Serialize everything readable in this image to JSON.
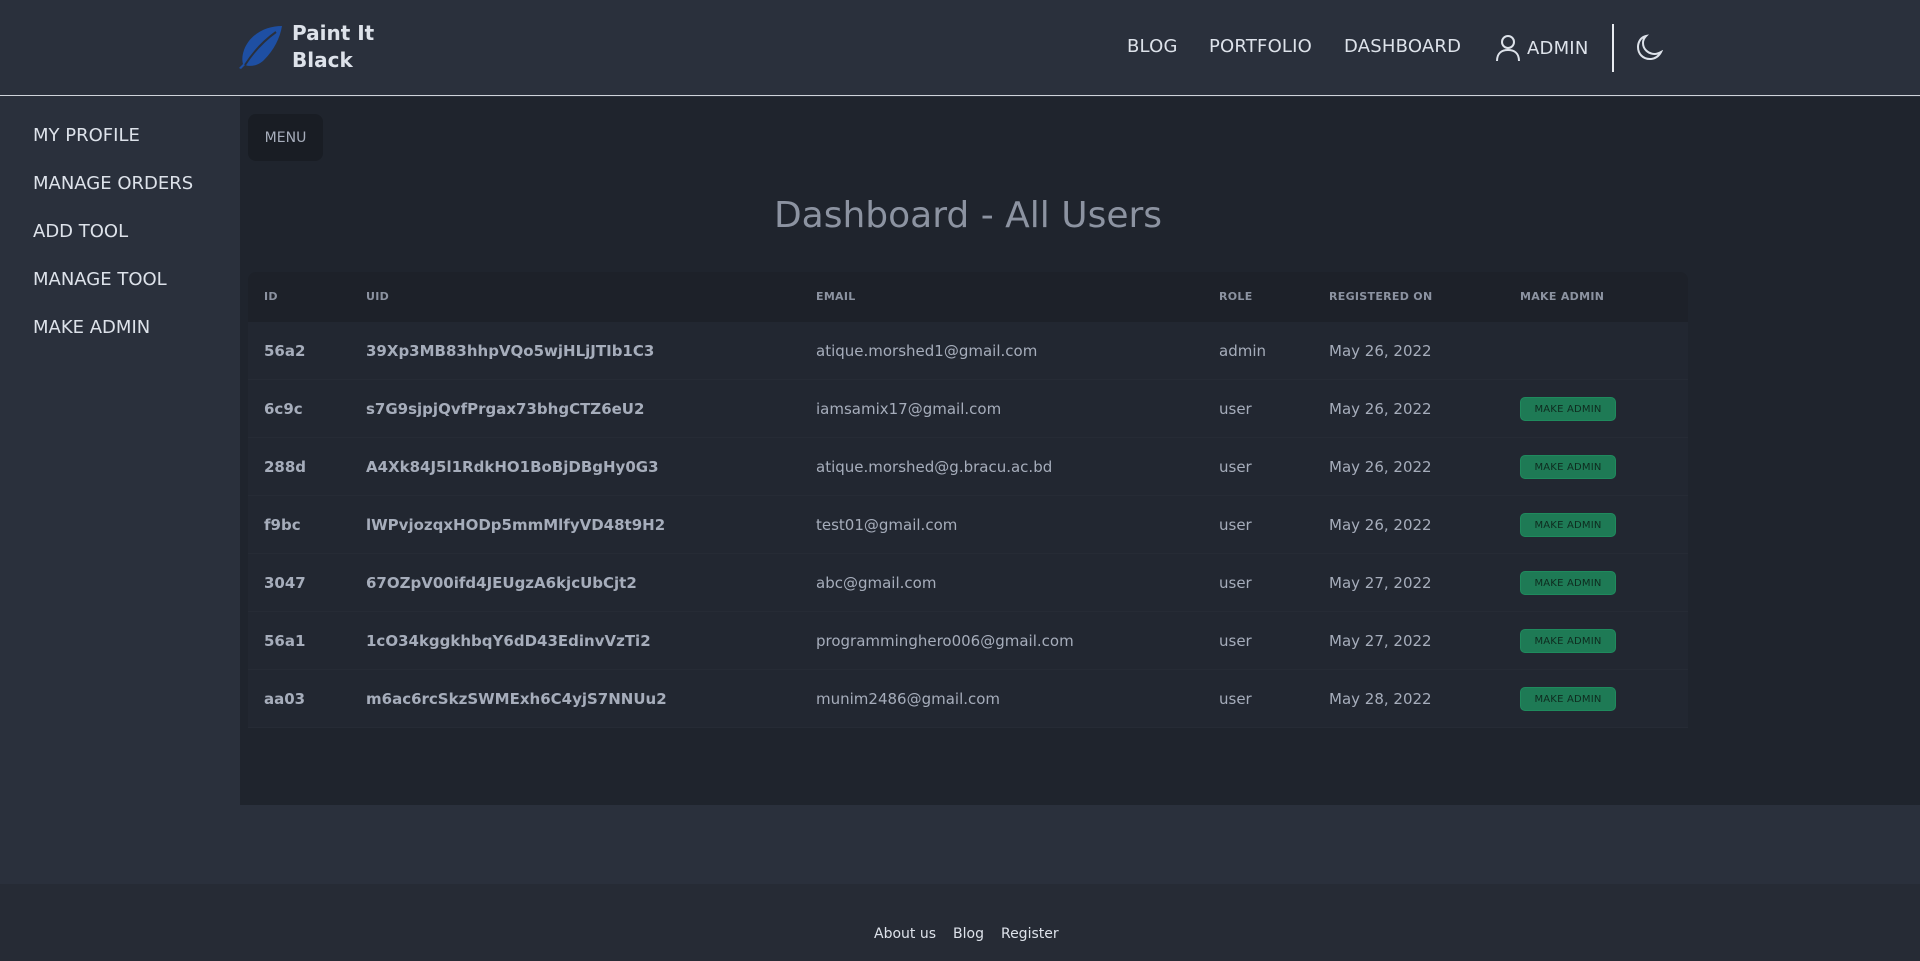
{
  "brand": {
    "line1": "Paint It",
    "line2": "Black",
    "logo_icon": "feather-icon"
  },
  "nav": {
    "blog": "BLOG",
    "portfolio": "PORTFOLIO",
    "dashboard": "DASHBOARD",
    "admin": "ADMIN",
    "admin_icon": "user-icon",
    "theme_icon": "moon-icon"
  },
  "sidebar": {
    "items": [
      "MY PROFILE",
      "MANAGE ORDERS",
      "ADD TOOL",
      "MANAGE TOOL",
      "MAKE ADMIN"
    ]
  },
  "main": {
    "menu_label": "MENU",
    "title": "Dashboard - All Users",
    "columns": [
      "ID",
      "UID",
      "EMAIL",
      "ROLE",
      "REGISTERED ON",
      "MAKE ADMIN"
    ],
    "rows": [
      {
        "id": "56a2",
        "uid": "39Xp3MB83hhpVQo5wjHLjJTIb1C3",
        "email": "atique.morshed1@gmail.com",
        "role": "admin",
        "registered": "May 26, 2022",
        "action": ""
      },
      {
        "id": "6c9c",
        "uid": "s7G9sjpjQvfPrgax73bhgCTZ6eU2",
        "email": "iamsamix17@gmail.com",
        "role": "user",
        "registered": "May 26, 2022",
        "action": "MAKE ADMIN"
      },
      {
        "id": "288d",
        "uid": "A4Xk84J5l1RdkHO1BoBjDBgHy0G3",
        "email": "atique.morshed@g.bracu.ac.bd",
        "role": "user",
        "registered": "May 26, 2022",
        "action": "MAKE ADMIN"
      },
      {
        "id": "f9bc",
        "uid": "lWPvjozqxHODp5mmMlfyVD48t9H2",
        "email": "test01@gmail.com",
        "role": "user",
        "registered": "May 26, 2022",
        "action": "MAKE ADMIN"
      },
      {
        "id": "3047",
        "uid": "67OZpV00ifd4JEUgzA6kjcUbCjt2",
        "email": "abc@gmail.com",
        "role": "user",
        "registered": "May 27, 2022",
        "action": "MAKE ADMIN"
      },
      {
        "id": "56a1",
        "uid": "1cO34kggkhbqY6dD43EdinvVzTi2",
        "email": "programminghero006@gmail.com",
        "role": "user",
        "registered": "May 27, 2022",
        "action": "MAKE ADMIN"
      },
      {
        "id": "aa03",
        "uid": "m6ac6rcSkzSWMExh6C4yjS7NNUu2",
        "email": "munim2486@gmail.com",
        "role": "user",
        "registered": "May 28, 2022",
        "action": "MAKE ADMIN"
      }
    ]
  },
  "footer": {
    "links": [
      "About us",
      "Blog",
      "Register"
    ]
  },
  "colors": {
    "page_bg": "#2a303c",
    "main_bg": "#1f242d",
    "accent_green": "#1e7a55",
    "logo_blue": "#1e4fa3"
  }
}
